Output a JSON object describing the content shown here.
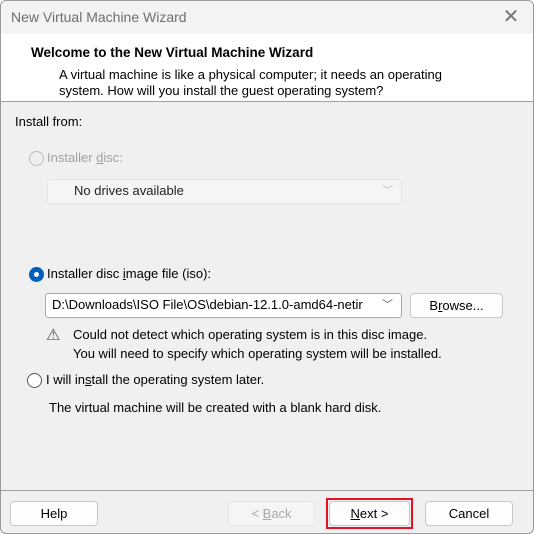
{
  "window": {
    "title": "New Virtual Machine Wizard",
    "close_icon": "close-icon"
  },
  "header": {
    "title": "Welcome to the New Virtual Machine Wizard",
    "description": "A virtual machine is like a physical computer; it needs an operating system. How will you install the guest operating system?"
  },
  "body": {
    "install_from_label": "Install from:",
    "disc_option": {
      "pre": "Installer ",
      "key": "d",
      "post": "isc:",
      "selected": false,
      "enabled": false
    },
    "disc_dropdown": {
      "value": "No drives available",
      "enabled": false
    },
    "iso_option": {
      "pre": "Installer disc ",
      "key": "i",
      "post": "mage file (iso):",
      "selected": true
    },
    "iso_dropdown": {
      "value": "D:\\Downloads\\ISO File\\OS\\debian-12.1.0-amd64-netir"
    },
    "browse_button": {
      "pre": "B",
      "key": "r",
      "post": "owse..."
    },
    "warning": {
      "icon": "warning-icon",
      "line1": "Could not detect which operating system is in this disc image.",
      "line2": "You will need to specify which operating system will be installed."
    },
    "later_option": {
      "pre": "I will in",
      "key": "s",
      "post": "tall the operating system later.",
      "selected": false
    },
    "later_note": "The virtual machine will be created with a blank hard disk."
  },
  "footer": {
    "help": "Help",
    "back": {
      "pre": "< ",
      "key": "B",
      "post": "ack",
      "enabled": false
    },
    "next": {
      "pre": "",
      "key": "N",
      "post": "ext >",
      "highlight_color": "#e81123"
    },
    "cancel": "Cancel"
  }
}
